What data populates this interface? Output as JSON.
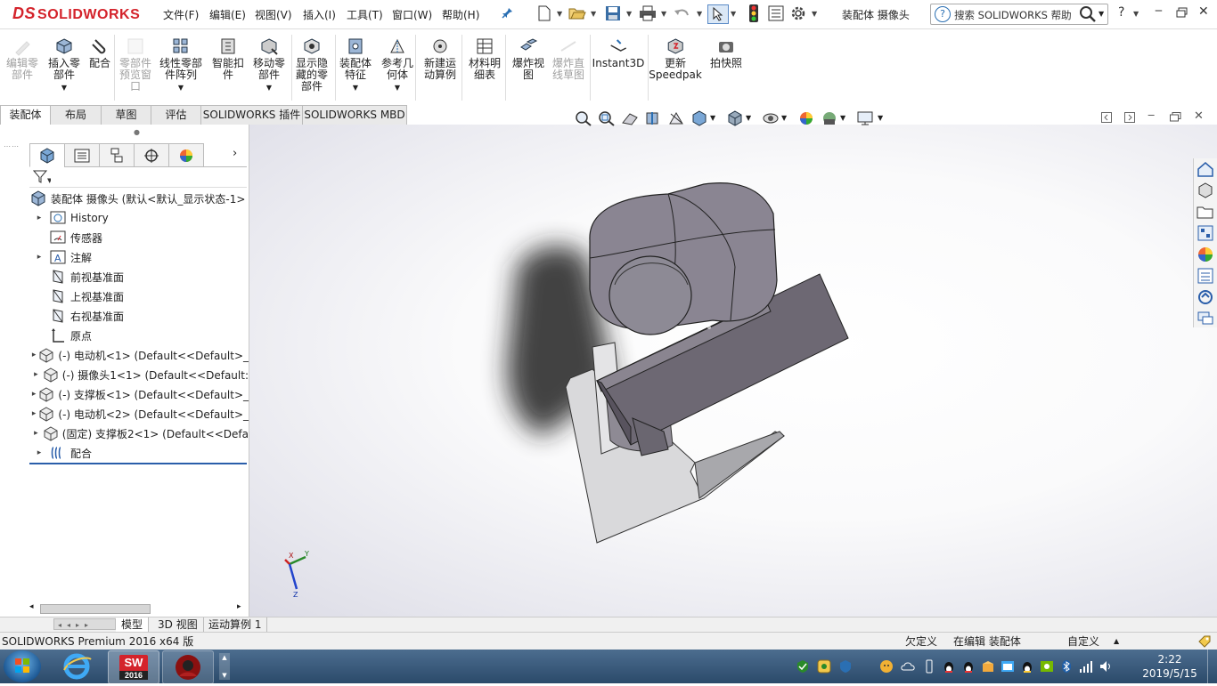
{
  "app": {
    "logo_text": "SOLIDWORKS",
    "logo_mark": "DS",
    "menu": [
      "文件(F)",
      "编辑(E)",
      "视图(V)",
      "插入(I)",
      "工具(T)",
      "窗口(W)",
      "帮助(H)"
    ],
    "doc_title": "装配体 摄像头",
    "search_placeholder": "搜索 SOLIDWORKS 帮助",
    "help_label": "?"
  },
  "commands": [
    {
      "label": "编辑零\n部件",
      "icon": "edit-component-icon",
      "enabled": false
    },
    {
      "label": "插入零\n部件",
      "icon": "insert-component-icon",
      "enabled": true
    },
    {
      "label": "配合",
      "icon": "mate-icon",
      "enabled": true
    },
    {
      "label": "零部件\n预览窗\n口",
      "icon": "component-preview-icon",
      "enabled": false
    },
    {
      "label": "线性零部\n件阵列",
      "icon": "linear-pattern-icon",
      "enabled": true
    },
    {
      "label": "智能扣\n件",
      "icon": "smart-fasteners-icon",
      "enabled": true
    },
    {
      "label": "移动零\n部件",
      "icon": "move-component-icon",
      "enabled": true
    },
    {
      "label": "显示隐\n藏的零\n部件",
      "icon": "show-hidden-icon",
      "enabled": true
    },
    {
      "label": "装配体\n特征",
      "icon": "assembly-features-icon",
      "enabled": true
    },
    {
      "label": "参考几\n何体",
      "icon": "reference-geometry-icon",
      "enabled": true
    },
    {
      "label": "新建运\n动算例",
      "icon": "new-motion-study-icon",
      "enabled": true
    },
    {
      "label": "材料明\n细表",
      "icon": "bom-icon",
      "enabled": true
    },
    {
      "label": "爆炸视\n图",
      "icon": "exploded-view-icon",
      "enabled": true
    },
    {
      "label": "爆炸直\n线草图",
      "icon": "explode-line-sketch-icon",
      "enabled": false
    },
    {
      "label": "Instant3D",
      "icon": "instant3d-icon",
      "enabled": true
    },
    {
      "label": "更新\nSpeedpak",
      "icon": "speedpak-icon",
      "enabled": true
    },
    {
      "label": "拍快照",
      "icon": "snapshot-icon",
      "enabled": true
    }
  ],
  "tabs": [
    "装配体",
    "布局",
    "草图",
    "评估",
    "SOLIDWORKS 插件",
    "SOLIDWORKS MBD"
  ],
  "tree": {
    "root": "装配体 摄像头  (默认<默认_显示状态-1>",
    "items": [
      {
        "label": "History",
        "icon": "history-icon",
        "expandable": true
      },
      {
        "label": "传感器",
        "icon": "sensor-icon",
        "expandable": false
      },
      {
        "label": "注解",
        "icon": "annotation-icon",
        "expandable": true
      },
      {
        "label": "前视基准面",
        "icon": "plane-icon",
        "expandable": false
      },
      {
        "label": "上视基准面",
        "icon": "plane-icon",
        "expandable": false
      },
      {
        "label": "右视基准面",
        "icon": "plane-icon",
        "expandable": false
      },
      {
        "label": "原点",
        "icon": "origin-icon",
        "expandable": false
      },
      {
        "label": "(-) 电动机<1>  (Default<<Default>_",
        "icon": "part-icon",
        "expandable": true
      },
      {
        "label": "(-) 摄像头1<1>  (Default<<Default:",
        "icon": "part-icon",
        "expandable": true
      },
      {
        "label": "(-) 支撑板<1>  (Default<<Default>_",
        "icon": "part-icon",
        "expandable": true
      },
      {
        "label": "(-) 电动机<2>  (Default<<Default>_",
        "icon": "part-icon",
        "expandable": true
      },
      {
        "label": "(固定) 支撑板2<1>  (Default<<Defa",
        "icon": "part-icon",
        "expandable": true
      },
      {
        "label": "配合",
        "icon": "mates-folder-icon",
        "expandable": true
      }
    ]
  },
  "bottom_tabs": [
    "模型",
    "3D 视图",
    "运动算例 1"
  ],
  "status": {
    "left": "SOLIDWORKS Premium 2016 x64 版",
    "underdefined": "欠定义",
    "editing": "在编辑 装配体",
    "custom": "自定义"
  },
  "taskbar": {
    "sw_badge": "2016",
    "sw_letters": "SW",
    "time": "2:22",
    "date": "2019/5/15"
  },
  "triad": {
    "x": "X",
    "y": "Y",
    "z": "Z"
  }
}
